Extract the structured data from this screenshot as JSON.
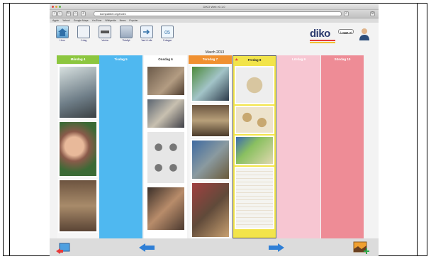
{
  "browser": {
    "window_title": "DIKO Web v0.1.0",
    "url": "kompatibel.org/index",
    "bookmarks": [
      "Apple",
      "Yahoo!",
      "Google Maps",
      "YouTube",
      "Wikipedia",
      "News",
      "Popular"
    ]
  },
  "toolbar": {
    "items": [
      {
        "label": "Hem"
      },
      {
        "label": "1 dag"
      },
      {
        "label": "Vecka"
      },
      {
        "label": "Tidsflyt"
      },
      {
        "label": "Vad & när"
      },
      {
        "label": "5 dagar"
      }
    ]
  },
  "logo": {
    "text": "diko"
  },
  "login_button": {
    "label": "Logga ut"
  },
  "calendar": {
    "month": "March 2013",
    "days": [
      {
        "label": "Måndag 4",
        "color": "#8cc63f",
        "bg": "#f6f6f6"
      },
      {
        "label": "Tisdag 5",
        "color": "#4fb8f0",
        "bg": "#4fb8f0"
      },
      {
        "label": "Onsdag 6",
        "color": "#ffffff",
        "bg": "#ffffff"
      },
      {
        "label": "Torsdag 7",
        "color": "#f09030",
        "bg": "#f6f6f6"
      },
      {
        "label": "Fredag 8",
        "color": "#f2e44a",
        "bg": "#f2e44a"
      },
      {
        "label": "Lördag 9",
        "color": "#f7c6d2",
        "bg": "#f7c6d2"
      },
      {
        "label": "Söndag 10",
        "color": "#ee8c96",
        "bg": "#ee8c96"
      }
    ]
  },
  "colors": {
    "accent_red": "#e63a3a",
    "arrow_blue": "#2f7fd6"
  }
}
